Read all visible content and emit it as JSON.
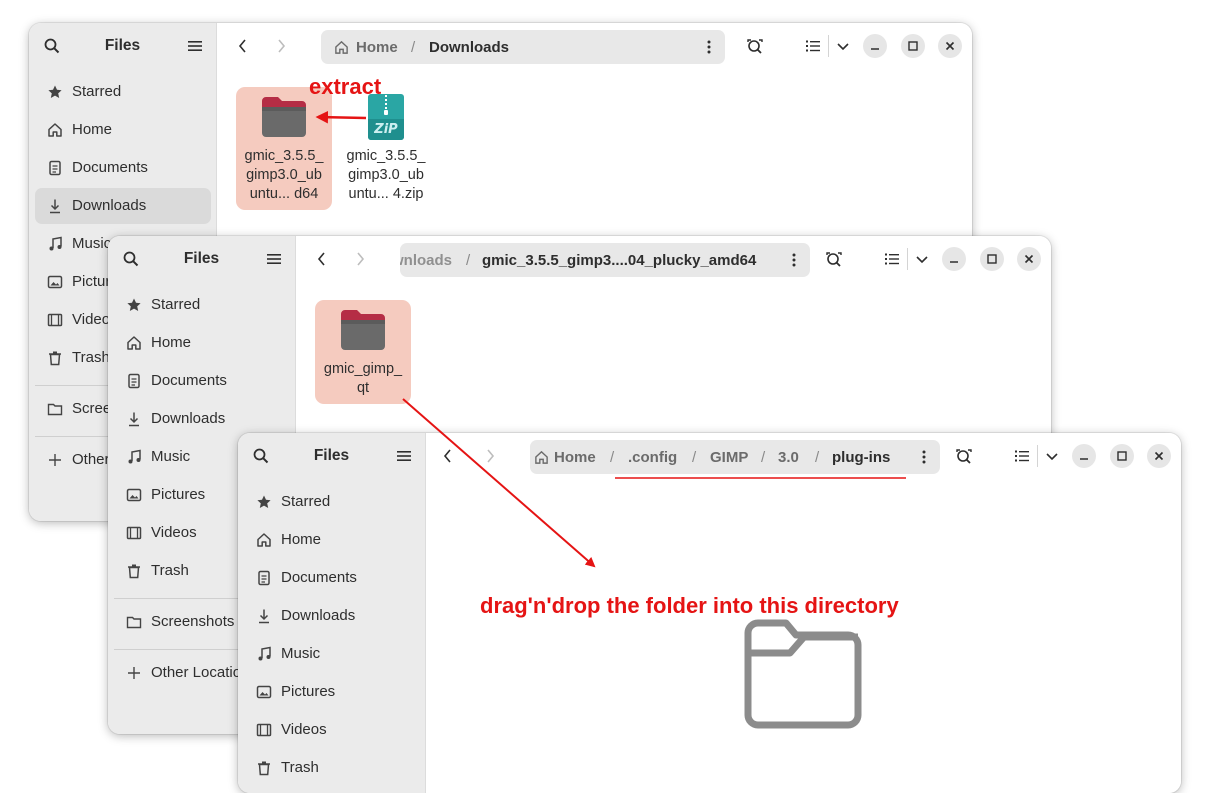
{
  "app_title": "Files",
  "windows": {
    "w1": {
      "sidebar": {
        "items": [
          {
            "label": "Starred",
            "icon": "star-icon"
          },
          {
            "label": "Home",
            "icon": "home-icon"
          },
          {
            "label": "Documents",
            "icon": "document-icon"
          },
          {
            "label": "Downloads",
            "icon": "download-icon"
          },
          {
            "label": "Music",
            "icon": "music-icon"
          },
          {
            "label": "Pictures",
            "icon": "picture-icon"
          },
          {
            "label": "Videos",
            "icon": "video-icon"
          },
          {
            "label": "Trash",
            "icon": "trash-icon"
          },
          {
            "label": "Screenshots",
            "icon": "folder-icon"
          },
          {
            "label": "Other Locations",
            "icon": "plus-icon"
          }
        ]
      },
      "path": {
        "segments": [
          "Home",
          "Downloads"
        ]
      },
      "files": [
        {
          "name_lines": [
            "gmic_3.5.5_",
            "gimp3.0_ub",
            "untu...   d64"
          ],
          "icon": "folder-icon"
        },
        {
          "name_lines": [
            "gmic_3.5.5_",
            "gimp3.0_ub",
            "untu... 4.zip"
          ],
          "icon": "zip-archive-icon"
        }
      ]
    },
    "w2": {
      "sidebar": {
        "items": [
          {
            "label": "Starred",
            "icon": "star-icon"
          },
          {
            "label": "Home",
            "icon": "home-icon"
          },
          {
            "label": "Documents",
            "icon": "document-icon"
          },
          {
            "label": "Downloads",
            "icon": "download-icon"
          },
          {
            "label": "Music",
            "icon": "music-icon"
          },
          {
            "label": "Pictures",
            "icon": "picture-icon"
          },
          {
            "label": "Videos",
            "icon": "video-icon"
          },
          {
            "label": "Trash",
            "icon": "trash-icon"
          },
          {
            "label": "Screenshots",
            "icon": "folder-icon"
          },
          {
            "label": "Other Locations",
            "icon": "plus-icon"
          }
        ]
      },
      "path": {
        "segments": [
          "wnloads",
          "gmic_3.5.5_gimp3....04_plucky_amd64"
        ]
      },
      "files": [
        {
          "name_lines": [
            "gmic_gimp_",
            "qt"
          ],
          "icon": "folder-icon"
        }
      ]
    },
    "w3": {
      "sidebar": {
        "items": [
          {
            "label": "Starred",
            "icon": "star-icon"
          },
          {
            "label": "Home",
            "icon": "home-icon"
          },
          {
            "label": "Documents",
            "icon": "document-icon"
          },
          {
            "label": "Downloads",
            "icon": "download-icon"
          },
          {
            "label": "Music",
            "icon": "music-icon"
          },
          {
            "label": "Pictures",
            "icon": "picture-icon"
          },
          {
            "label": "Videos",
            "icon": "video-icon"
          },
          {
            "label": "Trash",
            "icon": "trash-icon"
          }
        ]
      },
      "path": {
        "segments": [
          "Home",
          ".config",
          "GIMP",
          "3.0",
          "plug-ins"
        ]
      }
    }
  },
  "annotations": {
    "extract": "extract",
    "drag_drop": "drag'n'drop the folder into this directory"
  },
  "colors": {
    "annotation": "#e51414",
    "selection": "#f5cbbf",
    "folder_body": "#6a6a6a",
    "folder_tab": "#b52d45",
    "zip_icon": "#2aa6a4"
  }
}
